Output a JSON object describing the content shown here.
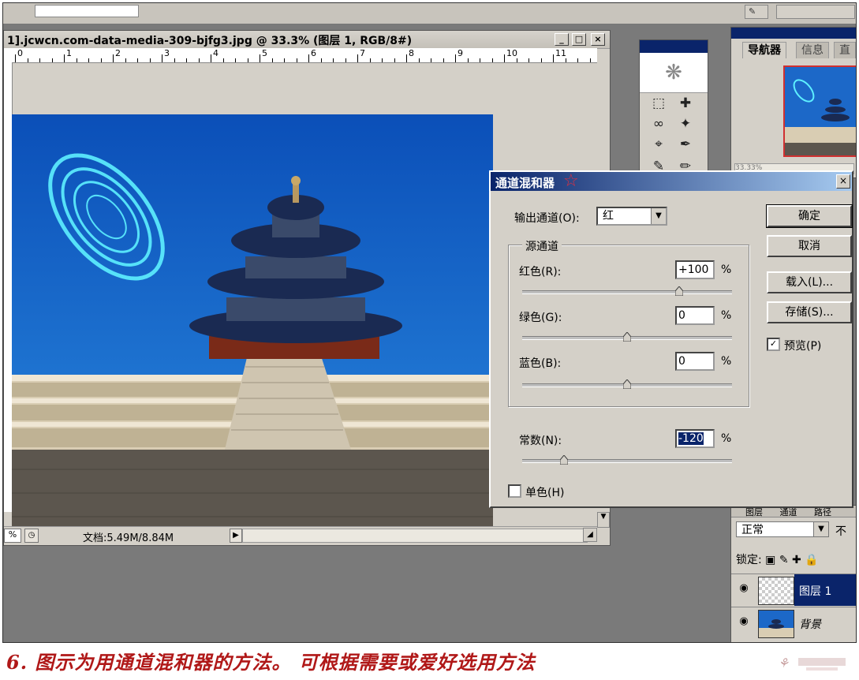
{
  "document": {
    "title": "1].jcwcn.com-data-media-309-bjfg3.jpg @ 33.3% (图层 1, RGB/8#)",
    "ruler_labels": [
      "0",
      "1",
      "2",
      "3",
      "4",
      "5",
      "6",
      "7",
      "8",
      "9",
      "10",
      "11"
    ],
    "zoom_partial": "%",
    "status": "文档:5.49M/8.84M",
    "window_buttons": {
      "minimize": "_",
      "maximize": "□",
      "close": "×"
    }
  },
  "navigator": {
    "tabs": [
      "导航器",
      "信息",
      "直"
    ],
    "zoom_partial": "33.33%"
  },
  "layers": {
    "tabs": [
      "图层",
      "通道",
      "路径"
    ],
    "blend_mode": "正常",
    "opacity_partial": "不",
    "lock_label": "锁定:",
    "items": [
      {
        "name": "图层 1",
        "selected": true
      },
      {
        "name": "背景",
        "selected": false
      }
    ]
  },
  "dialog": {
    "title": "通道混和器",
    "output_channel_label": "输出通道(O):",
    "output_channel_value": "红",
    "source_group": "源通道",
    "sources": [
      {
        "label": "红色(R):",
        "value": "+100",
        "unit": "%",
        "slider": 0.75
      },
      {
        "label": "绿色(G):",
        "value": "0",
        "unit": "%",
        "slider": 0.5
      },
      {
        "label": "蓝色(B):",
        "value": "0",
        "unit": "%",
        "slider": 0.5
      }
    ],
    "constant": {
      "label": "常数(N):",
      "value": "-120",
      "unit": "%",
      "slider": 0.2
    },
    "monochrome_label": "单色(H)",
    "buttons": {
      "ok": "确定",
      "cancel": "取消",
      "load": "载入(L)...",
      "save": "存储(S)..."
    },
    "preview_label": "预览(P)",
    "preview_checked": true
  },
  "caption": "6. 图示为用通道混和器的方法。 可根据需要或爱好选用方法",
  "colors": {
    "title_blue": "#0a246a",
    "caption_red": "#b01818",
    "sky": "#1c68c8"
  }
}
